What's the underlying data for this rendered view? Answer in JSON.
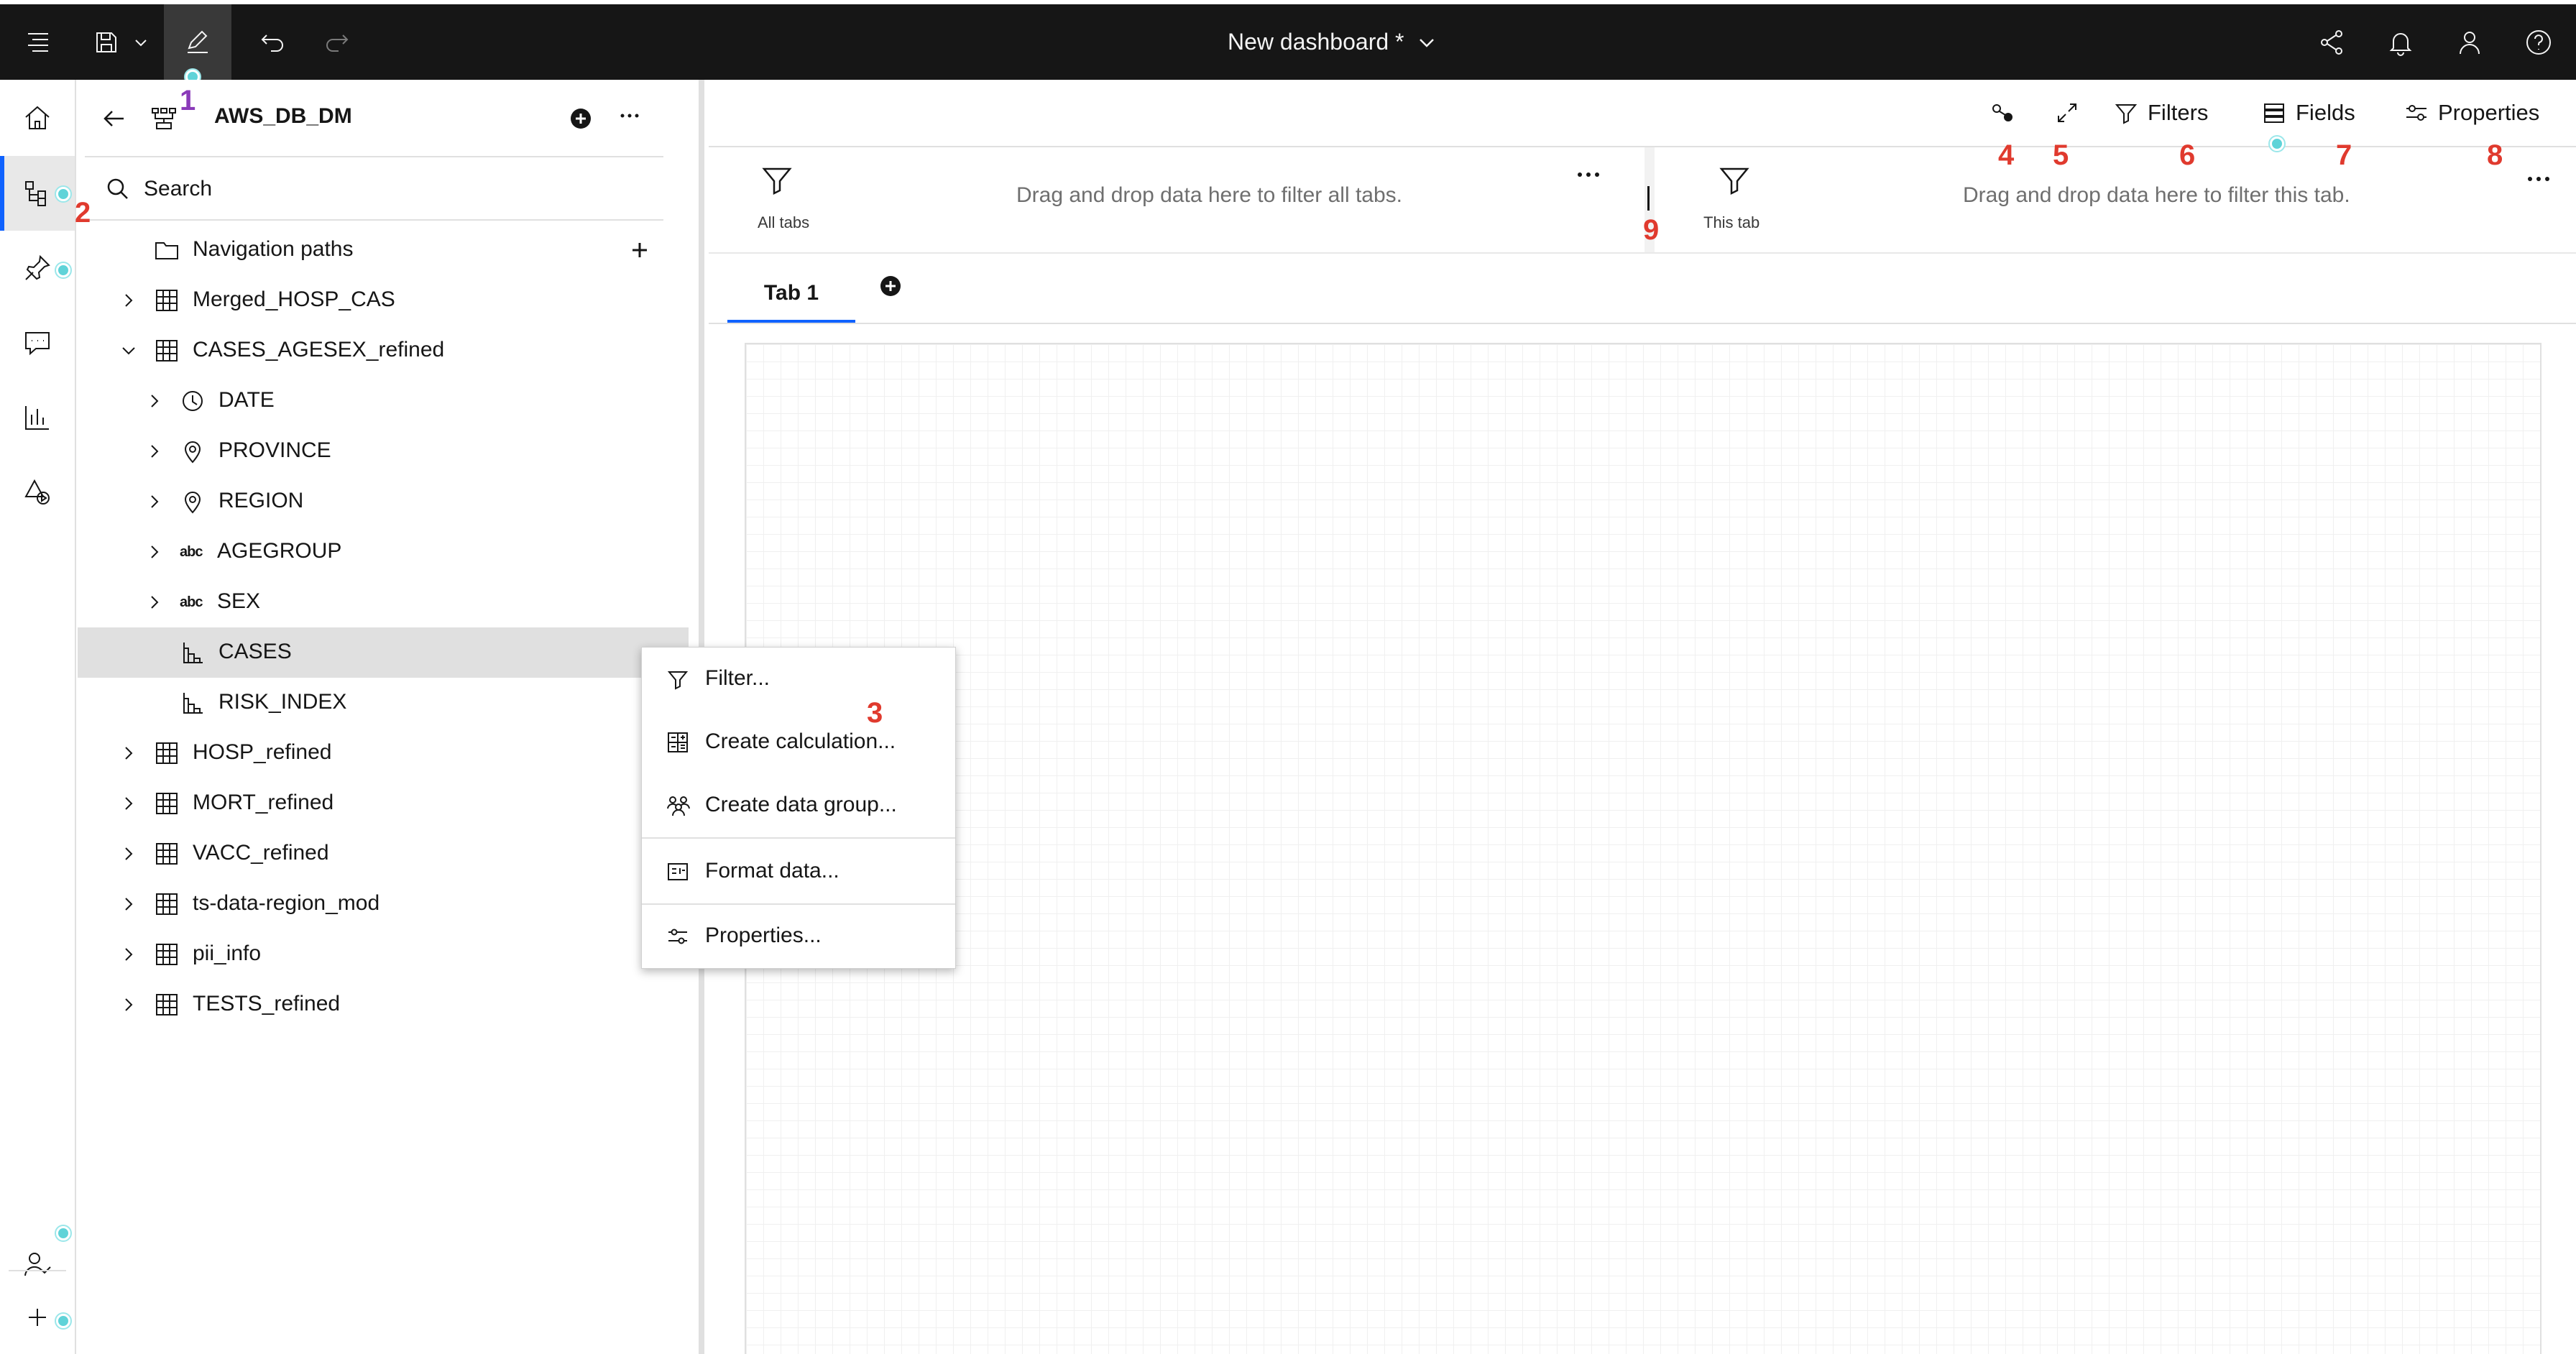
{
  "topbar": {
    "title": "New dashboard *",
    "icons": [
      "app-menu-icon",
      "save-icon",
      "chevron-down-icon",
      "edit-pencil-icon",
      "undo-icon",
      "redo-icon",
      "share-icon",
      "notification-bell-icon",
      "user-icon",
      "help-icon"
    ]
  },
  "rail": {
    "icons": [
      "home-icon",
      "data-tree-icon",
      "pin-icon",
      "chat-icon",
      "chart-icon",
      "shapes-icon",
      "user-check-icon",
      "plus-icon"
    ]
  },
  "panel": {
    "source_name": "AWS_DB_DM",
    "search_placeholder": "Search",
    "tree": [
      {
        "label": "Navigation paths",
        "type": "folder"
      },
      {
        "label": "Merged_HOSP_CAS",
        "type": "table"
      },
      {
        "label": "CASES_AGESEX_refined",
        "type": "table",
        "expanded": true
      },
      {
        "label": "DATE",
        "type": "date"
      },
      {
        "label": "PROVINCE",
        "type": "location"
      },
      {
        "label": "REGION",
        "type": "location"
      },
      {
        "label": "AGEGROUP",
        "type": "text",
        "type_glyph": "abc"
      },
      {
        "label": "SEX",
        "type": "text",
        "type_glyph": "abc"
      },
      {
        "label": "CASES",
        "type": "measure",
        "selected": true
      },
      {
        "label": "RISK_INDEX",
        "type": "measure"
      },
      {
        "label": "HOSP_refined",
        "type": "table"
      },
      {
        "label": "MORT_refined",
        "type": "table"
      },
      {
        "label": "VACC_refined",
        "type": "table"
      },
      {
        "label": "ts-data-region_mod",
        "type": "table"
      },
      {
        "label": "pii_info",
        "type": "table"
      },
      {
        "label": "TESTS_refined",
        "type": "table"
      }
    ]
  },
  "context_menu": {
    "items": [
      {
        "label": "Filter...",
        "icon": "filter-icon"
      },
      {
        "label": "Create calculation...",
        "icon": "calculation-icon"
      },
      {
        "label": "Create data group...",
        "icon": "data-group-icon"
      },
      {
        "label": "Format data...",
        "icon": "format-data-icon"
      },
      {
        "label": "Properties...",
        "icon": "properties-icon"
      }
    ]
  },
  "toolbar": {
    "filters_label": "Filters",
    "fields_label": "Fields",
    "properties_label": "Properties"
  },
  "filter_bar": {
    "all_tabs_label": "All tabs",
    "all_tabs_hint": "Drag and drop data here to filter all tabs.",
    "this_tab_label": "This tab",
    "this_tab_hint": "Drag and drop data here to filter this tab."
  },
  "tabs": {
    "tab1_label": "Tab 1"
  },
  "annotations": [
    "1",
    "2",
    "3",
    "4",
    "5",
    "6",
    "7",
    "8",
    "9"
  ],
  "colors": {
    "topbar_bg": "#161616",
    "accent": "#0f62fe",
    "annotation_red": "#e03a2e",
    "annotation_purple": "#8a3ab9",
    "dot_teal": "#5fd3d8"
  }
}
